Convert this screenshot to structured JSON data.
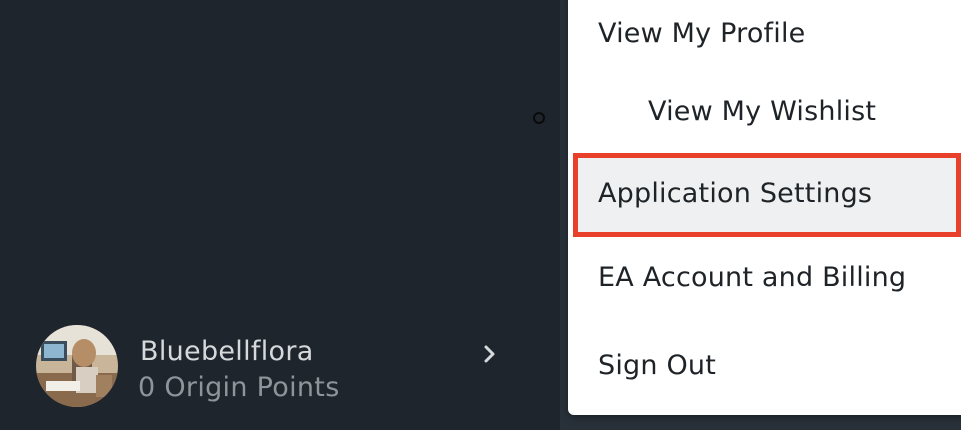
{
  "menu": {
    "items": [
      {
        "label": "View My Profile"
      },
      {
        "label": "View My Wishlist"
      },
      {
        "label": "Application Settings"
      },
      {
        "label": "EA Account and Billing"
      },
      {
        "label": "Sign Out"
      }
    ],
    "highlighted_item": "Application Settings",
    "highlight_color": "#e8402a"
  },
  "profile": {
    "username": "Bluebellflora",
    "points": "0 Origin Points",
    "avatar_icon": "user-avatar",
    "expand_icon": "chevron-right-icon"
  },
  "colors": {
    "background": "#1f252c",
    "menu_background": "#ffffff",
    "menu_text": "#1e2328"
  }
}
